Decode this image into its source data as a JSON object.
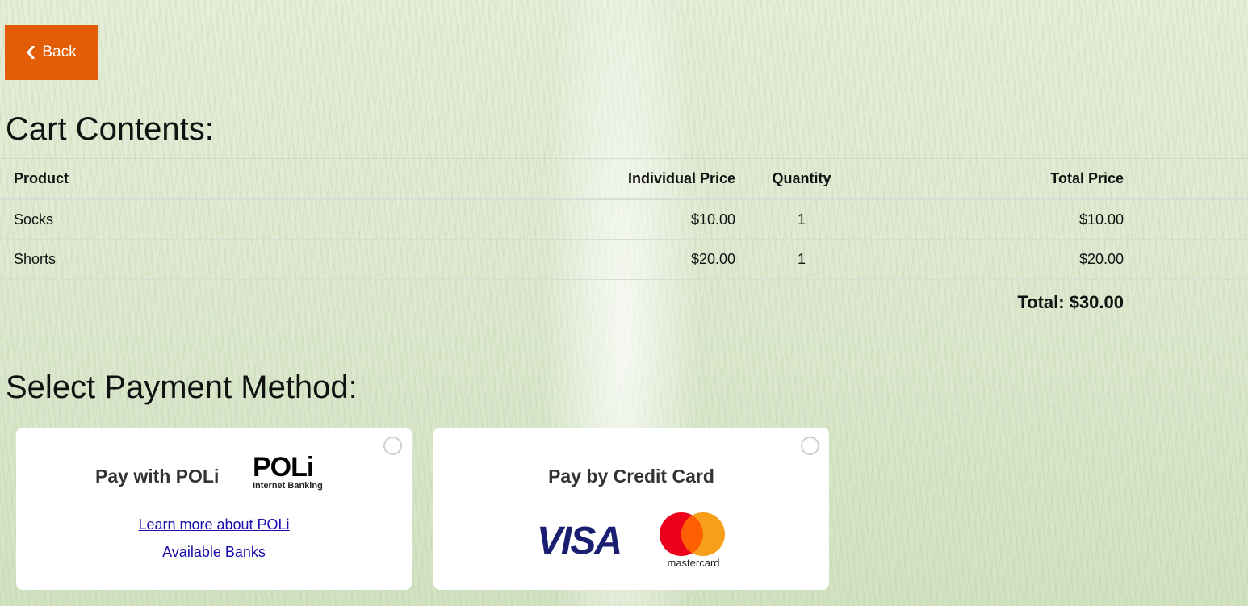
{
  "nav": {
    "back_label": "Back"
  },
  "cart": {
    "title": "Cart Contents:",
    "columns": [
      "Product",
      "Individual Price",
      "Quantity",
      "Total Price"
    ],
    "rows": [
      {
        "product": "Socks",
        "price": "$10.00",
        "qty": "1",
        "total": "$10.00"
      },
      {
        "product": "Shorts",
        "price": "$20.00",
        "qty": "1",
        "total": "$20.00"
      }
    ],
    "total_label": "Total: $30.00"
  },
  "payment": {
    "title": "Select Payment Method:",
    "poli": {
      "heading": "Pay with POLi",
      "logo_word": "POLi",
      "logo_sub": "Internet Banking",
      "learn_more": "Learn more about POLi",
      "banks": "Available Banks"
    },
    "credit_card": {
      "heading": "Pay by Credit Card",
      "visa_text": "VISA",
      "mastercard_text": "mastercard"
    }
  },
  "colors": {
    "accent": "#e35d06",
    "link": "#1a0dab",
    "visa_blue": "#1a1f71",
    "mc_red": "#eb001b",
    "mc_orange": "#f79e1b"
  }
}
